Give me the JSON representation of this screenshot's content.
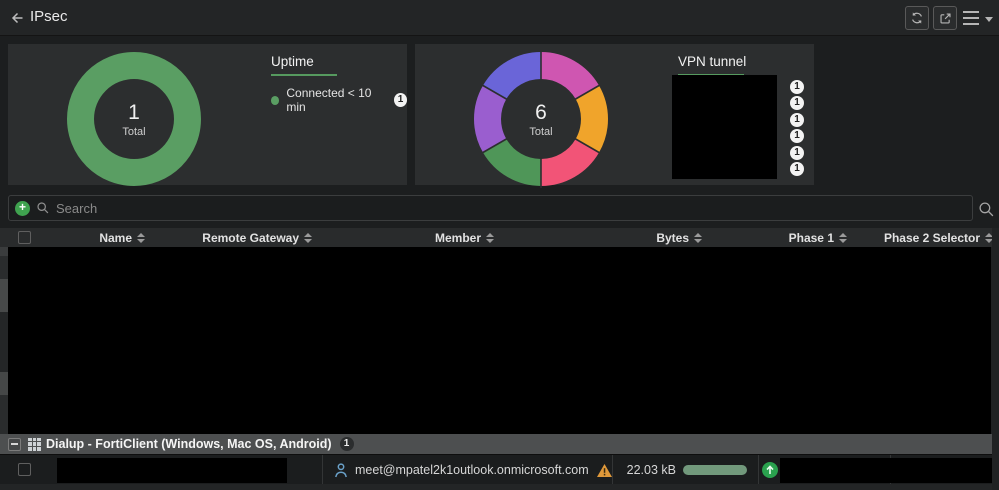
{
  "topbar": {
    "title": "IPsec",
    "buttons": [
      "refresh",
      "open-in-new",
      "menu"
    ]
  },
  "widgets": {
    "uptime": {
      "title": "Uptime",
      "total": "1",
      "total_label": "Total",
      "ring_color": "#5a9e63",
      "legend": [
        {
          "label": "Connected < 10 min",
          "count": "1",
          "color": "#5a9e63"
        }
      ]
    },
    "vpn_tunnel": {
      "title": "VPN tunnel",
      "total": "6",
      "total_label": "Total",
      "slice_colors": [
        "#cf56b1",
        "#f0a42b",
        "#f25477",
        "#4f9658",
        "#9a5ecf",
        "#6a65d8"
      ],
      "legend_counts": [
        "1",
        "1",
        "1",
        "1",
        "1",
        "1"
      ]
    }
  },
  "chart_data": [
    {
      "type": "pie",
      "title": "Uptime",
      "categories": [
        "Connected < 10 min"
      ],
      "values": [
        1
      ],
      "total": 1,
      "colors": [
        "#5a9e63"
      ],
      "legend_position": "right"
    },
    {
      "type": "pie",
      "title": "VPN tunnel",
      "categories": [
        "redacted",
        "redacted",
        "redacted",
        "redacted",
        "redacted",
        "redacted"
      ],
      "values": [
        1,
        1,
        1,
        1,
        1,
        1
      ],
      "total": 6,
      "colors": [
        "#cf56b1",
        "#f0a42b",
        "#f25477",
        "#4f9658",
        "#9a5ecf",
        "#6a65d8"
      ],
      "legend_position": "right"
    }
  ],
  "search": {
    "placeholder": "Search"
  },
  "table": {
    "columns": [
      "Name",
      "Remote Gateway",
      "Member",
      "Bytes",
      "Phase 1",
      "Phase 2 Selector"
    ],
    "group_row": {
      "label": "Dialup - FortiClient (Windows, Mac OS, Android)",
      "count": "1"
    },
    "row": {
      "member": "meet@mpatel2k1outlook.onmicrosoft.com",
      "bytes": "22.03 kB"
    }
  },
  "colors": {
    "accent_green": "#569a5f",
    "search_add": "#3fa24f",
    "warning": "#e0993a",
    "bytes_bar": "#72997c",
    "phase_up": "#2aa14e",
    "member_icon": "#6aa1c9"
  }
}
